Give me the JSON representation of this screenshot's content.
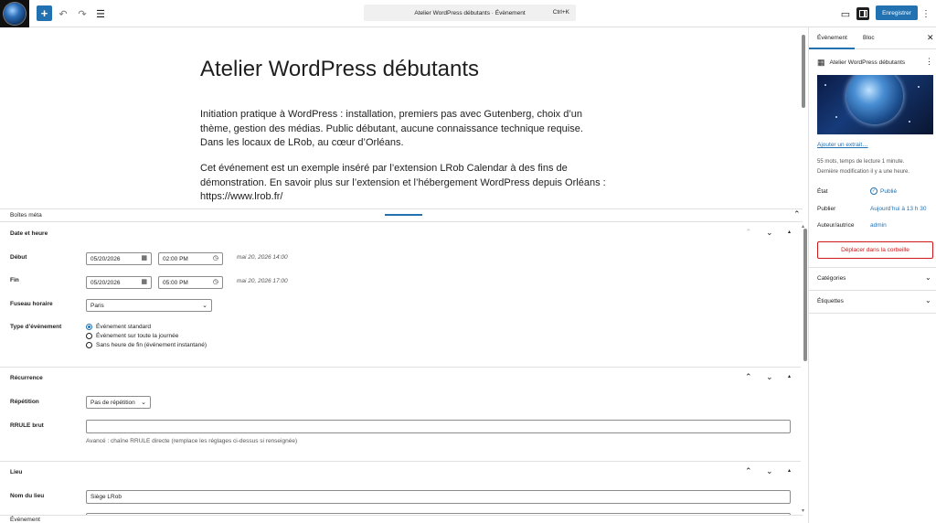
{
  "topbar": {
    "add_icon": "plus-icon",
    "command_title": "Atelier WordPress débutants · Évènement",
    "command_shortcut": "Ctrl+K",
    "save_label": "Enregistrer"
  },
  "post": {
    "title": "Atelier WordPress débutants",
    "paragraph1": "Initiation pratique à WordPress : installation, premiers pas avec Gutenberg, choix d’un thème, gestion des médias. Public débutant, aucune connaissance technique requise. Dans les locaux de LRob, au cœur d’Orléans.",
    "paragraph2": "Cet événement est un exemple inséré par l’extension LRob Calendar à des fins de démonstration. En savoir plus sur l’extension et l’hébergement WordPress depuis Orléans : https://www.lrob.fr/"
  },
  "meta": {
    "header_label": "Boîtes méta",
    "date_box": {
      "title": "Date et heure",
      "start_label": "Début",
      "start_date": "05/20/2026",
      "start_time": "02:00 PM",
      "start_hint": "mai 20, 2026 14:00",
      "end_label": "Fin",
      "end_date": "05/20/2026",
      "end_time": "05:00 PM",
      "end_hint": "mai 20, 2026 17:00",
      "tz_label": "Fuseau horaire",
      "tz_value": "Paris",
      "type_label": "Type d’événement",
      "type_options": [
        "Événement standard",
        "Événement sur toute la journée",
        "Sans heure de fin (événement instantané)"
      ]
    },
    "recurrence_box": {
      "title": "Récurrence",
      "repeat_label": "Répétition",
      "repeat_value": "Pas de répétition",
      "rrule_label": "RRULE brut",
      "rrule_value": "",
      "rrule_desc": "Avancé : chaîne RRULE directe (remplace les réglages ci-dessus si renseignée)"
    },
    "place_box": {
      "title": "Lieu",
      "name_label": "Nom du lieu",
      "name_value": "Siège LRob"
    },
    "footer_label": "Événement"
  },
  "sidebar": {
    "tab_event": "Événement",
    "tab_block": "Bloc",
    "post_name": "Atelier WordPress débutants",
    "excerpt_link": "Ajouter un extrait…",
    "stats_line1": "55 mots, temps de lecture 1 minute.",
    "stats_line2": "Dernière modification il y a une heure.",
    "status_label": "État",
    "status_value": "Publié",
    "publish_label": "Publier",
    "publish_value": "Aujourd’hui à 13 h 30",
    "author_label": "Auteur/autrice",
    "author_value": "admin",
    "trash_label": "Déplacer dans la corbeille",
    "categories_label": "Catégories",
    "tags_label": "Étiquettes"
  },
  "colors": {
    "accent": "#2271b1",
    "danger": "#cc1818"
  }
}
